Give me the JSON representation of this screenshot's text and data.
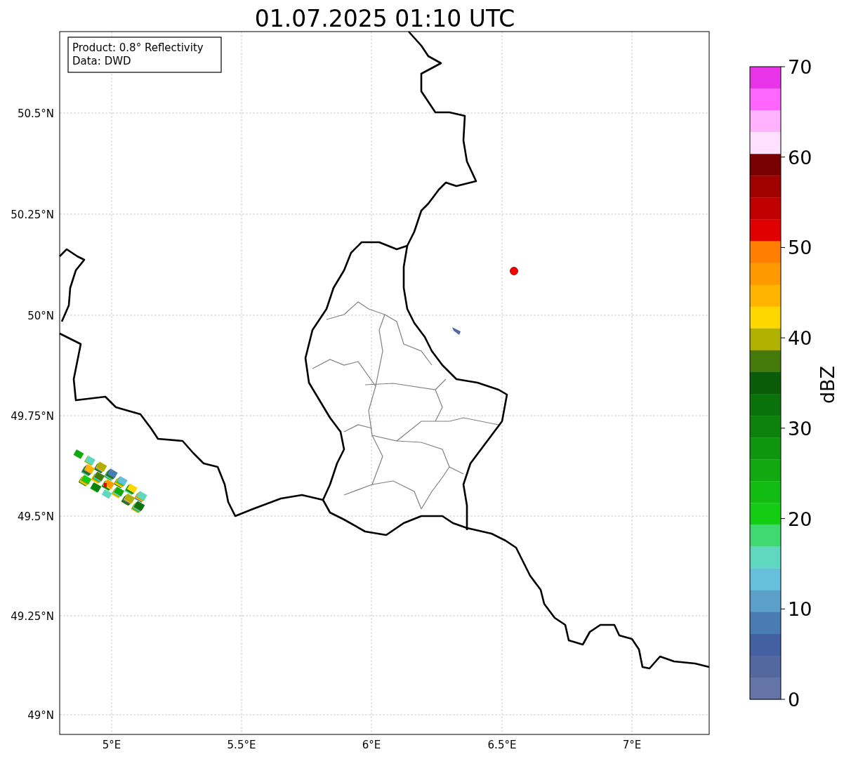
{
  "title": "01.07.2025 01:10 UTC",
  "info_box": [
    "Product: 0.8° Reflectivity",
    "Data: DWD"
  ],
  "y_ticks": [
    "50.5°N",
    "50.25°N",
    "50°N",
    "49.75°N",
    "49.5°N",
    "49.25°N",
    "49°N"
  ],
  "x_ticks": [
    "5°E",
    "5.5°E",
    "6°E",
    "6.5°E",
    "7°E"
  ],
  "colorbar": {
    "label": "dBZ",
    "ticks": [
      "70",
      "60",
      "50",
      "40",
      "30",
      "20",
      "10",
      "0"
    ],
    "bins": [
      {
        "color": "#e833e8"
      },
      {
        "color": "#ff66ff"
      },
      {
        "color": "#ffb3ff"
      },
      {
        "color": "#ffe0ff"
      },
      {
        "color": "#780000"
      },
      {
        "color": "#a00000"
      },
      {
        "color": "#c00000"
      },
      {
        "color": "#e00000"
      },
      {
        "color": "#ff7f00"
      },
      {
        "color": "#ff9900"
      },
      {
        "color": "#ffb400"
      },
      {
        "color": "#ffd700"
      },
      {
        "color": "#b0b000"
      },
      {
        "color": "#447a0a"
      },
      {
        "color": "#0a5c0a"
      },
      {
        "color": "#0a720a"
      },
      {
        "color": "#0c820c"
      },
      {
        "color": "#0e960e"
      },
      {
        "color": "#10aa10"
      },
      {
        "color": "#12bc12"
      },
      {
        "color": "#14cc14"
      },
      {
        "color": "#40d870"
      },
      {
        "color": "#60d8c0"
      },
      {
        "color": "#66c0dc"
      },
      {
        "color": "#5aa0c8"
      },
      {
        "color": "#4a7cb4"
      },
      {
        "color": "#4260a2"
      },
      {
        "color": "#5468a0"
      },
      {
        "color": "#6474a6"
      }
    ]
  }
}
